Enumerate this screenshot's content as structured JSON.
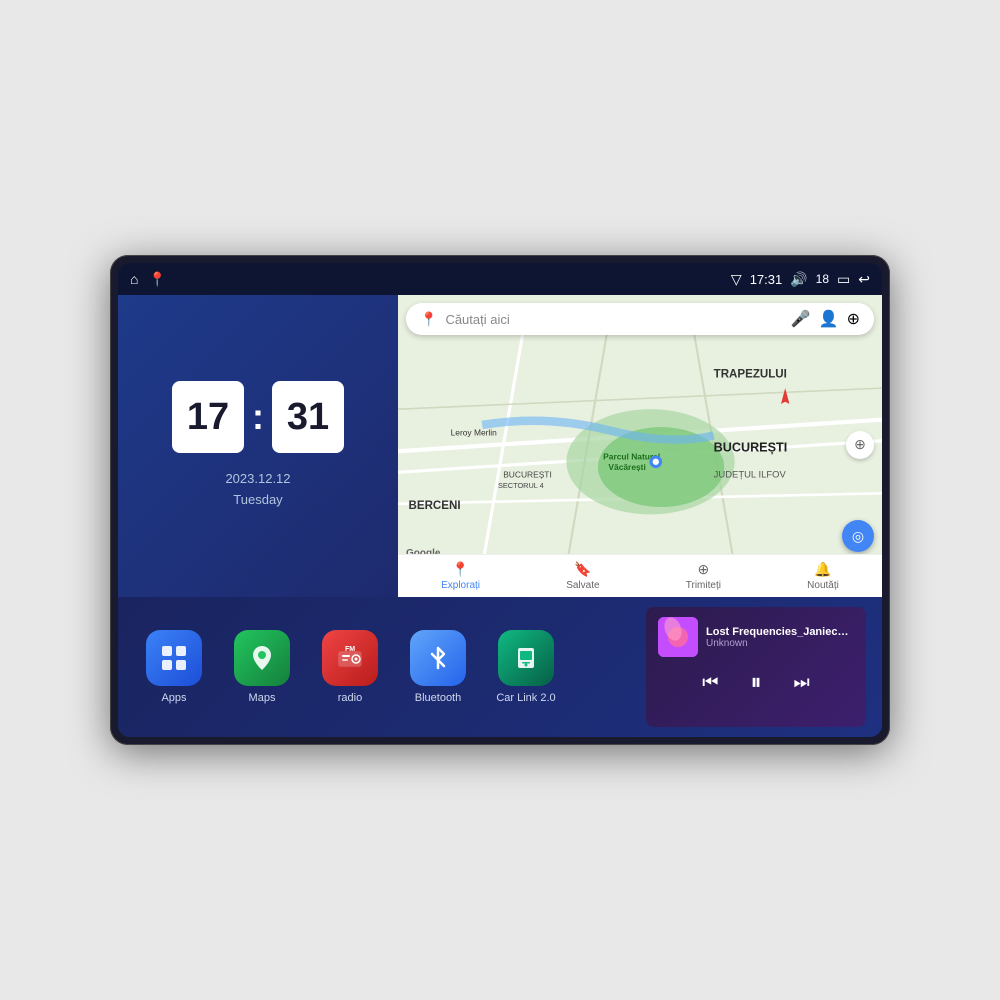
{
  "device": {
    "status_bar": {
      "signal_icon": "▽",
      "time": "17:31",
      "volume_icon": "🔊",
      "battery_level": "18",
      "battery_icon": "🔋",
      "back_icon": "↩"
    },
    "home_icon": "⌂",
    "maps_shortcut_icon": "📍"
  },
  "clock_widget": {
    "hours": "17",
    "minutes": "31",
    "date": "2023.12.12",
    "day": "Tuesday"
  },
  "map_widget": {
    "search_placeholder": "Căutați aici",
    "voice_icon": "🎤",
    "account_icon": "👤",
    "layers_icon": "⊕",
    "location_name": "Parcul Natural Văcărești",
    "district": "BUCUREȘTI SECTORUL 4",
    "area1": "BUCUREȘTI",
    "area2": "JUDEȚUL ILFOV",
    "area3": "BERCENI",
    "area4": "TRAPEZULUI",
    "street": "Leroy Merlin",
    "google_logo": "Google",
    "nav_items": [
      {
        "label": "Explorați",
        "icon": "📍",
        "active": true
      },
      {
        "label": "Salvate",
        "icon": "🔖",
        "active": false
      },
      {
        "label": "Trimiteți",
        "icon": "⊕",
        "active": false
      },
      {
        "label": "Noutăți",
        "icon": "🔔",
        "active": false
      }
    ]
  },
  "app_icons": [
    {
      "id": "apps",
      "label": "Apps",
      "bg_color": "#3b82f6",
      "icon": "⊞"
    },
    {
      "id": "maps",
      "label": "Maps",
      "bg_color": "#22c55e",
      "icon": "📍"
    },
    {
      "id": "radio",
      "label": "radio",
      "bg_color": "#ef4444",
      "icon": "📻"
    },
    {
      "id": "bluetooth",
      "label": "Bluetooth",
      "bg_color": "#3b82f6",
      "icon": "⦿"
    },
    {
      "id": "carlink",
      "label": "Car Link 2.0",
      "bg_color": "#10b981",
      "icon": "📱"
    }
  ],
  "music_player": {
    "title": "Lost Frequencies_Janieck Devy-...",
    "artist": "Unknown",
    "prev_icon": "⏮",
    "play_icon": "⏸",
    "next_icon": "⏭"
  }
}
